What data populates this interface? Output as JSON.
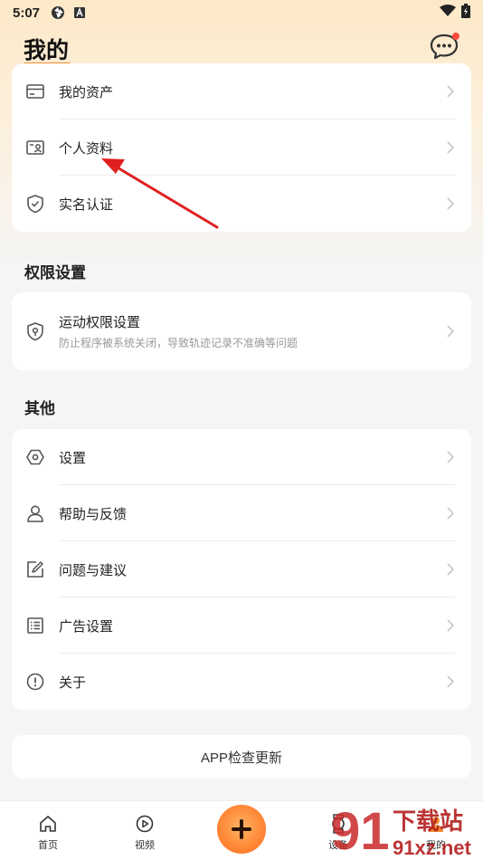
{
  "status_bar": {
    "time": "5:07"
  },
  "header": {
    "title": "我的"
  },
  "account_card": {
    "items": [
      {
        "label": "我的资产",
        "icon": "wallet-icon"
      },
      {
        "label": "个人资料",
        "icon": "id-card-icon"
      },
      {
        "label": "实名认证",
        "icon": "shield-check-icon"
      }
    ]
  },
  "permissions": {
    "title": "权限设置",
    "item": {
      "label": "运动权限设置",
      "sublabel": "防止程序被系统关闭，导致轨迹记录不准确等问题",
      "icon": "shield-location-icon"
    }
  },
  "other": {
    "title": "其他",
    "items": [
      {
        "label": "设置",
        "icon": "settings-hex-icon"
      },
      {
        "label": "帮助与反馈",
        "icon": "person-icon"
      },
      {
        "label": "问题与建议",
        "icon": "edit-note-icon"
      },
      {
        "label": "广告设置",
        "icon": "list-icon"
      },
      {
        "label": "关于",
        "icon": "info-exclamation-icon"
      }
    ]
  },
  "update_button": "APP检查更新",
  "tabbar": {
    "tabs": [
      {
        "label": "首页",
        "icon": "home-icon"
      },
      {
        "label": "视频",
        "icon": "play-circle-icon"
      },
      {
        "label": "设备",
        "icon": "watch-icon"
      },
      {
        "label": "我的",
        "icon": "profile-icon"
      }
    ]
  },
  "watermark": {
    "text": "下载站",
    "site": "91xz.net",
    "num": "91"
  },
  "colors": {
    "accent": "#f08a2c",
    "badge": "#ff4a3d",
    "arrow": "#e02020"
  }
}
